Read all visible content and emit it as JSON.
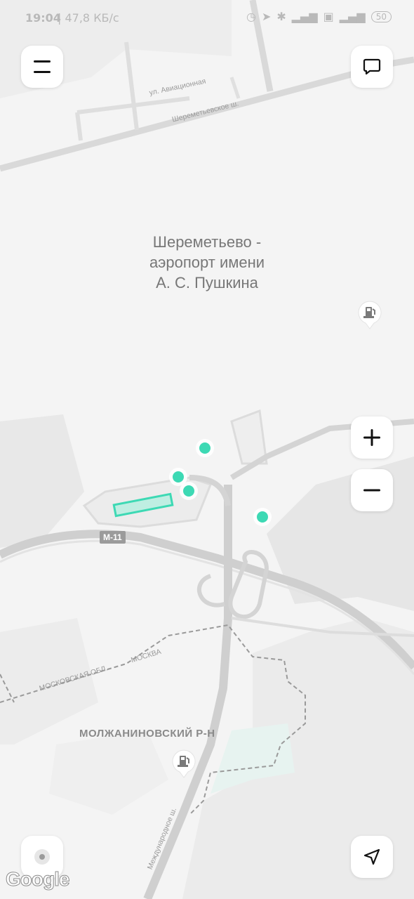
{
  "status_bar": {
    "time": "19:04",
    "speed": "| 47,8 КБ/с",
    "battery": "50",
    "icons": [
      "alarm-icon",
      "location-icon",
      "bluetooth-icon",
      "signal-icon",
      "sim-icon",
      "wifi-icon",
      "battery-icon"
    ]
  },
  "map": {
    "place_label": "Шереметьево - аэропорт имени А. С. Пушкина",
    "district_label": "МОЛЖАНИНОВСКИЙ Р-Н",
    "streets": {
      "aviatsionnaya": "ул. Авиационная",
      "sheremetyevskoe": "Шереметьевское ш.",
      "mezhdunarodnoe": "Международное ш.",
      "moskovskaya_obl": "МОСКОВСКАЯ ОБЛ.",
      "moskva": "МОСКВА"
    },
    "highway_shield": "М-11",
    "attribution": "Google",
    "colors": {
      "background": "#f4f4f4",
      "road": "#d6d6d6",
      "marker": "#3dd9b4",
      "zone_fill": "#bfeee2",
      "zone_stroke": "#3dd9b4"
    }
  },
  "controls": {
    "menu": "menu-icon",
    "chat": "chat-icon",
    "zoom_in": "+",
    "zoom_out": "−",
    "locate": "location-arrow-icon",
    "compass": "compass-icon"
  }
}
